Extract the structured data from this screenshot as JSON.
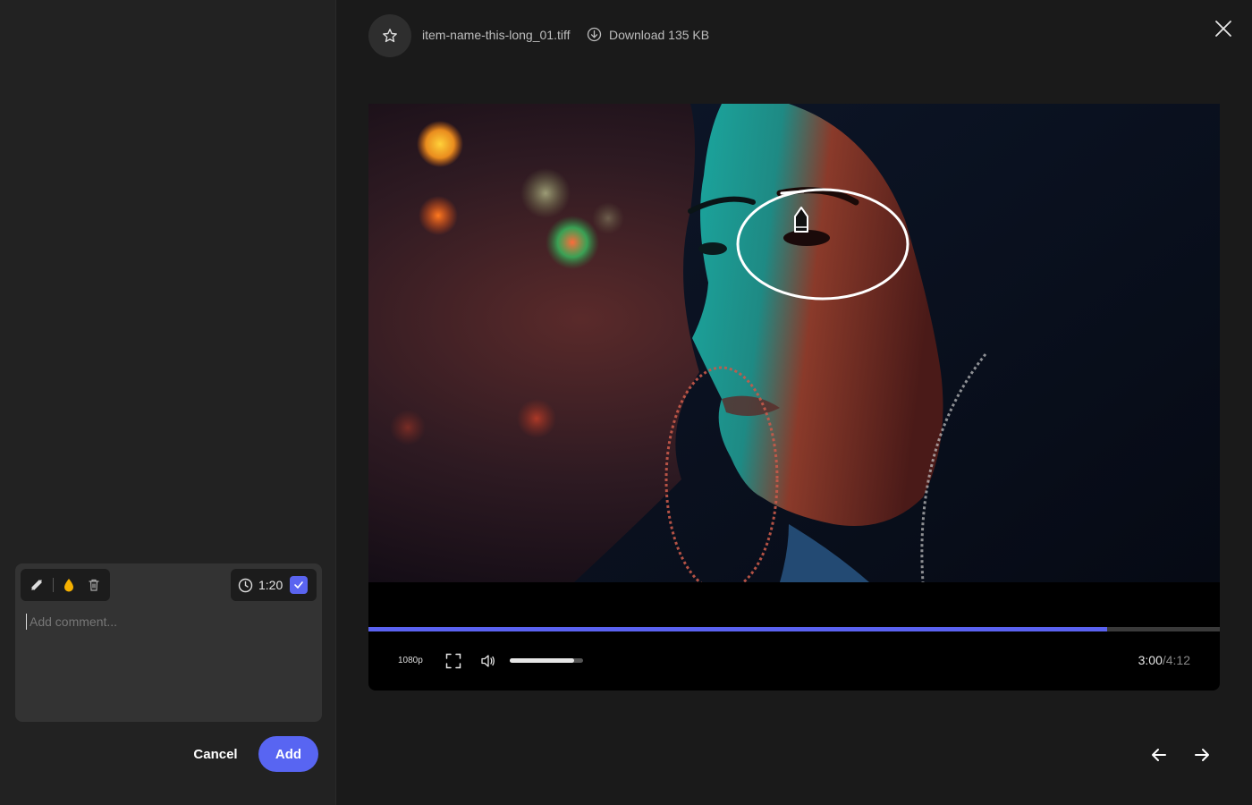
{
  "header": {
    "file_name": "item-name-this-long_01.tiff",
    "download_label": "Download 135 KB"
  },
  "comment": {
    "placeholder": "Add comment...",
    "timestamp": "1:20",
    "cancel_label": "Cancel",
    "add_label": "Add",
    "accent_color": "#5865f2",
    "drop_color": "#f5b000"
  },
  "player": {
    "quality": "1080p",
    "current_time": "3:00",
    "total_time": "/4:12",
    "progress_fraction": 0.868,
    "volume_fraction": 0.88
  },
  "icons": [
    "star-icon",
    "download-icon",
    "close-icon",
    "pen-icon",
    "drop-icon",
    "trash-icon",
    "clock-icon",
    "check-icon",
    "fullscreen-icon",
    "volume-icon",
    "arrow-left-icon",
    "arrow-right-icon"
  ]
}
